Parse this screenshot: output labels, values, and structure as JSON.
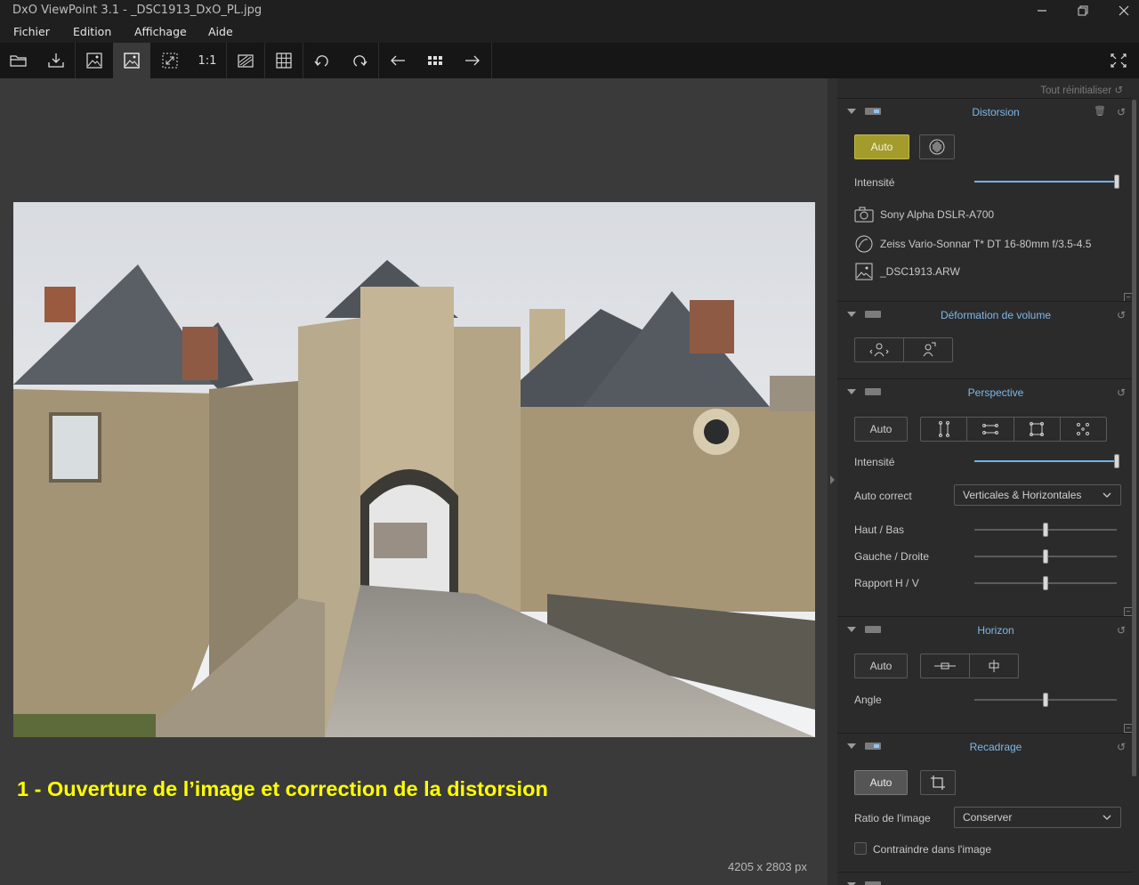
{
  "window": {
    "title": "DxO ViewPoint 3.1 - _DSC1913_DxO_PL.jpg"
  },
  "menu": {
    "items": [
      "Fichier",
      "Edition",
      "Affichage",
      "Aide"
    ]
  },
  "toolbar": {
    "one_to_one_label": "1:1",
    "icons": [
      "open-folder-icon",
      "export-icon",
      "single-view-icon",
      "image-view-icon",
      "fit-icon",
      "zoom-1-1",
      "before-after-icon",
      "grid-icon",
      "rotate-left-icon",
      "rotate-right-icon",
      "previous-icon",
      "thumbnails-icon",
      "next-icon",
      "fullscreen-icon"
    ]
  },
  "viewer": {
    "caption": "1 - Ouverture de l’image et correction de la distorsion",
    "image_size": "4205 x 2803 px"
  },
  "panel": {
    "reset_all": "Tout réinitialiser",
    "distortion": {
      "title": "Distorsion",
      "auto_label": "Auto",
      "intensity_label": "Intensité",
      "intensity_value": 1.0,
      "camera": "Sony Alpha DSLR-A700",
      "lens": "Zeiss Vario-Sonnar T* DT 16-80mm f/3.5-4.5",
      "file": "_DSC1913.ARW"
    },
    "volume": {
      "title": "Déformation de volume"
    },
    "perspective": {
      "title": "Perspective",
      "auto_label": "Auto",
      "intensity_label": "Intensité",
      "intensity_value": 1.0,
      "auto_correct_label": "Auto correct",
      "auto_correct_value": "Verticales & Horizontales",
      "top_bottom_label": "Haut / Bas",
      "left_right_label": "Gauche / Droite",
      "ratio_label": "Rapport H / V",
      "top_bottom_value": 0.5,
      "left_right_value": 0.5,
      "ratio_value": 0.5
    },
    "horizon": {
      "title": "Horizon",
      "auto_label": "Auto",
      "angle_label": "Angle",
      "angle_value": 0.5
    },
    "crop": {
      "title": "Recadrage",
      "auto_label": "Auto",
      "ratio_label": "Ratio de l'image",
      "ratio_value": "Conserver",
      "constrain_label": "Contraindre dans l'image",
      "constrain_checked": false
    }
  }
}
